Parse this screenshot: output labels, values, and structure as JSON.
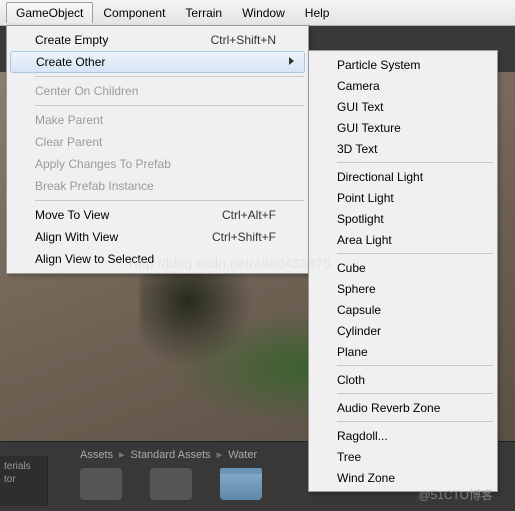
{
  "menubar": {
    "items": [
      "GameObject",
      "Component",
      "Terrain",
      "Window",
      "Help"
    ],
    "active_index": 0
  },
  "dropdown": {
    "create_empty": "Create Empty",
    "create_empty_shortcut": "Ctrl+Shift+N",
    "create_other": "Create Other",
    "center_on_children": "Center On Children",
    "make_parent": "Make Parent",
    "clear_parent": "Clear Parent",
    "apply_changes": "Apply Changes To Prefab",
    "break_prefab": "Break Prefab Instance",
    "move_to_view": "Move To View",
    "move_to_view_shortcut": "Ctrl+Alt+F",
    "align_with_view": "Align With View",
    "align_with_view_shortcut": "Ctrl+Shift+F",
    "align_view_to_selected": "Align View to Selected"
  },
  "submenu": {
    "particle_system": "Particle System",
    "camera": "Camera",
    "gui_text": "GUI Text",
    "gui_texture": "GUI Texture",
    "text_3d": "3D Text",
    "directional_light": "Directional Light",
    "point_light": "Point Light",
    "spotlight": "Spotlight",
    "area_light": "Area Light",
    "cube": "Cube",
    "sphere": "Sphere",
    "capsule": "Capsule",
    "cylinder": "Cylinder",
    "plane": "Plane",
    "cloth": "Cloth",
    "audio_reverb_zone": "Audio Reverb Zone",
    "ragdoll": "Ragdoll...",
    "tree": "Tree",
    "wind_zone": "Wind Zone"
  },
  "breadcrumb": {
    "a": "Assets",
    "b": "Standard Assets",
    "c": "Water"
  },
  "tabs": {
    "line1": "terials",
    "line2": "tor"
  },
  "watermarks": {
    "w1": "http://blog.csdn.net/a980433875",
    "w2": "@51CTO博客"
  }
}
